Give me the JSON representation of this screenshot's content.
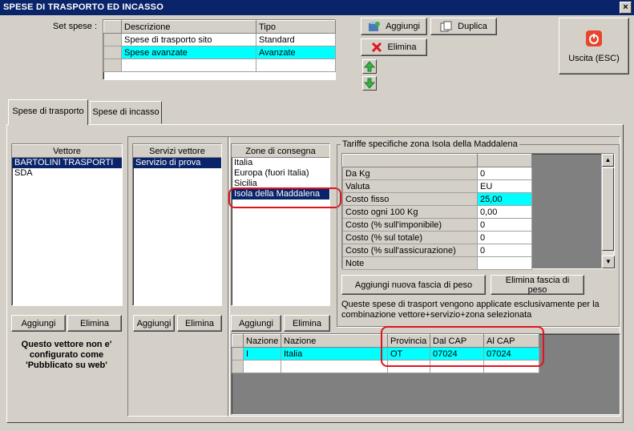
{
  "window": {
    "title": "SPESE DI TRASPORTO ED INCASSO",
    "close": "×"
  },
  "set_spese": {
    "label": "Set spese :",
    "columns": [
      "Descrizione",
      "Tipo"
    ],
    "rows": [
      {
        "descrizione": "Spese di trasporto sito",
        "tipo": "Standard"
      },
      {
        "descrizione": "Spese avanzate",
        "tipo": "Avanzate"
      }
    ]
  },
  "toolbar": {
    "aggiungi": "Aggiungi",
    "duplica": "Duplica",
    "elimina": "Elimina",
    "uscita": "Uscita (ESC)"
  },
  "tabs": {
    "trasporto": "Spese di trasporto",
    "incasso": "Spese di incasso"
  },
  "vettore": {
    "header": "Vettore",
    "items": [
      "BARTOLINI TRASPORTI",
      "SDA"
    ],
    "aggiungi": "Aggiungi",
    "elimina": "Elimina",
    "note": "Questo vettore non e' configurato come 'Pubblicato su web'"
  },
  "servizi": {
    "header": "Servizi vettore",
    "items": [
      "Servizio di prova"
    ],
    "aggiungi": "Aggiungi",
    "elimina": "Elimina"
  },
  "zone": {
    "header": "Zone di consegna",
    "items": [
      "Italia",
      "Europa (fuori Italia)",
      "Sicilia",
      "Isola della Maddalena"
    ],
    "aggiungi": "Aggiungi",
    "elimina": "Elimina"
  },
  "tariffe": {
    "title": "Tariffe specifiche zona Isola della Maddalena",
    "rows": [
      {
        "label": "Da Kg",
        "value": "0"
      },
      {
        "label": "Valuta",
        "value": "EU"
      },
      {
        "label": "Costo fisso",
        "value": "25,00"
      },
      {
        "label": "Costo ogni 100 Kg",
        "value": "0,00"
      },
      {
        "label": "Costo (% sull'imponibile)",
        "value": "0"
      },
      {
        "label": "Costo (% sul totale)",
        "value": "0"
      },
      {
        "label": "Costo (% sull'assicurazione)",
        "value": "0"
      },
      {
        "label": "Note",
        "value": ""
      }
    ],
    "aggiungi_fascia": "Aggiungi nuova fascia di peso",
    "elimina_fascia": "Elimina fascia di peso",
    "info": "Queste spese di trasport vengono applicate esclusivamente per la combinazione vettore+servizio+zona selezionata"
  },
  "cap_grid": {
    "columns": [
      "Nazione",
      "Nazione",
      "Provincia",
      "Dal CAP",
      "Al CAP"
    ],
    "rows": [
      {
        "cod": "I",
        "nazione": "Italia",
        "provincia": "OT",
        "dal": "07024",
        "al": "07024"
      }
    ]
  },
  "colors": {
    "selected_row": "#00ffff",
    "list_selected": "#0a246a",
    "highlight": "#e0141e"
  }
}
